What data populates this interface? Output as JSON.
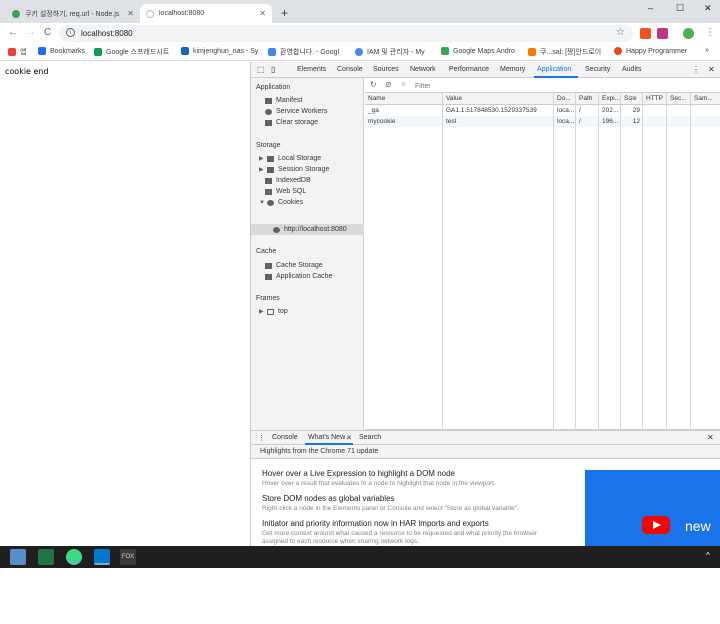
{
  "browser": {
    "tabs": [
      {
        "title": "쿠키 설정하기, req.url - Node.js",
        "active": false
      },
      {
        "title": "localhost:8080",
        "active": true
      }
    ],
    "new_tab_symbol": "+",
    "window_controls": {
      "minimize": "–",
      "maximize": "☐",
      "close": "✕"
    },
    "nav": {
      "back": "←",
      "forward": "→",
      "reload": "C"
    },
    "omnibox": {
      "info_symbol": "i",
      "url": "localhost:8080",
      "star": "☆"
    },
    "menu_symbol": "⋮",
    "bookmarks": [
      {
        "label": "앱",
        "icon": "apps-icon",
        "color": "#ea4335"
      },
      {
        "label": "Bookmarks",
        "icon": "star-icon",
        "color": "#1a73e8"
      },
      {
        "label": "Google 스프레드시트",
        "icon": "sheets-icon",
        "color": "#0f9d58"
      },
      {
        "label": "kimjenghun_nas - Sy",
        "icon": "dsm-icon",
        "color": "#1565c0"
      },
      {
        "label": "환영합니다. - Googl",
        "icon": "gcp-icon",
        "color": "#4285f4"
      },
      {
        "label": "IAM 및 관리자 - My",
        "icon": "google-icon",
        "color": "#4285f4"
      },
      {
        "label": "Google Maps Andro",
        "icon": "maps-icon",
        "color": "#34a853"
      },
      {
        "label": "쿠...sal: [짱]안드로이",
        "icon": "blogger-icon",
        "color": "#f57c00"
      },
      {
        "label": "Happy Programmer",
        "icon": "happy-icon",
        "color": "#e64a19"
      }
    ],
    "bookmarks_overflow": "»"
  },
  "page": {
    "text": "cookie end"
  },
  "devtools": {
    "tabs": [
      "Elements",
      "Console",
      "Sources",
      "Network",
      "Performance",
      "Memory",
      "Application",
      "Security",
      "Audits"
    ],
    "active_tab": "Application",
    "sidebar": {
      "application_heading": "Application",
      "application_items": [
        "Manifest",
        "Service Workers",
        "Clear storage"
      ],
      "storage_heading": "Storage",
      "storage_items": [
        "Local Storage",
        "Session Storage",
        "IndexedDB",
        "Web SQL",
        "Cookies"
      ],
      "cookie_origin": "http://localhost:8080",
      "cache_heading": "Cache",
      "cache_items": [
        "Cache Storage",
        "Application Cache"
      ],
      "frames_heading": "Frames",
      "frames_items": [
        "top"
      ]
    },
    "cookies": {
      "filter_placeholder": "Filter",
      "columns": [
        "Name",
        "Value",
        "Do...",
        "Path",
        "Expi...",
        "Size",
        "HTTP",
        "Sec...",
        "Sam..."
      ],
      "rows": [
        [
          "_ga",
          "GA1.1.517848530.1529337539",
          "loca...",
          "/",
          "202...",
          "29",
          "",
          "",
          ""
        ],
        [
          "mycookie",
          "test",
          "loca...",
          "/",
          "196...",
          "12",
          "",
          "",
          ""
        ]
      ]
    },
    "drawer": {
      "tabs": [
        "Console",
        "What's New",
        "Search"
      ],
      "active_tab": "What's New",
      "header": "Highlights from the Chrome 71 update",
      "items": [
        {
          "title": "Hover over a Live Expression to highlight a DOM node",
          "desc": "Hover over a result that evaluates to a node to highlight that node in the viewport."
        },
        {
          "title": "Store DOM nodes as global variables",
          "desc": "Right-click a node in the Elements panel or Console and select \"Store as global variable\"."
        },
        {
          "title": "Initiator and priority information now in HAR imports and exports",
          "desc": "Get more context around what caused a resource to be requested and what priority the browser assigned to each resource when sharing network logs."
        }
      ],
      "video_label": "new"
    }
  },
  "taskbar": {
    "apps": [
      {
        "name": "files-icon",
        "color": "#5b8cc9"
      },
      {
        "name": "excel-icon",
        "color": "#217346"
      },
      {
        "name": "android-studio-icon",
        "color": "#3ddc84"
      },
      {
        "name": "vscode-icon",
        "color": "#007acc"
      },
      {
        "name": "fox-icon",
        "color": "#3a3a3a"
      }
    ],
    "fox_label": "FOX"
  }
}
